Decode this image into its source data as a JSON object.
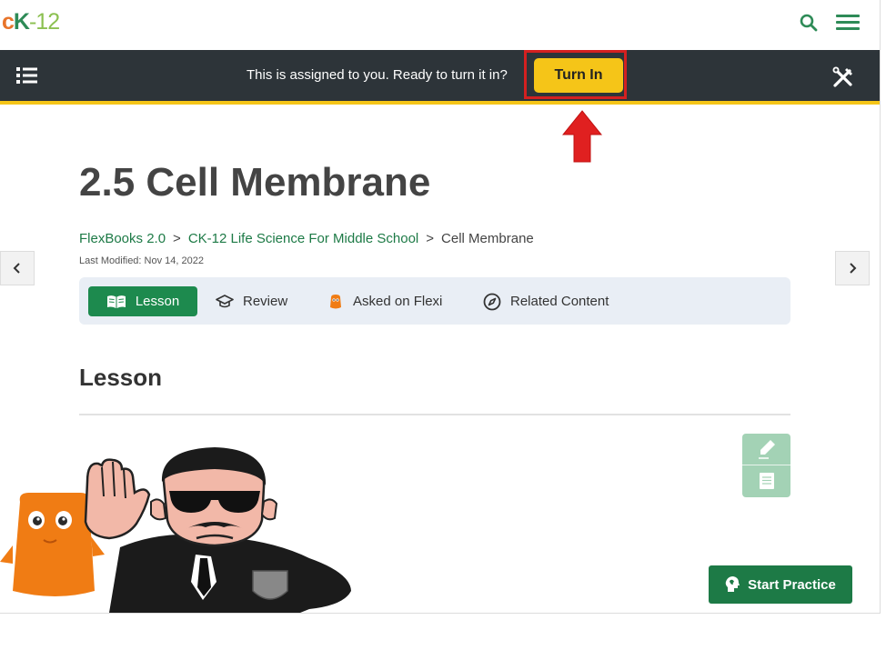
{
  "header": {
    "logo_c": "c",
    "logo_k": "K",
    "logo_rest": "-12",
    "search_icon": "search-icon",
    "menu_icon": "hamburger-menu-icon"
  },
  "assignment_bar": {
    "message": "This is assigned to you. Ready to turn it in?",
    "turn_in_label": "Turn In",
    "accent_color": "#f5c518",
    "highlight_color": "#d42020"
  },
  "page": {
    "title": "2.5 Cell Membrane",
    "breadcrumb": [
      {
        "label": "FlexBooks 2.0"
      },
      {
        "label": "CK-12 Life Science For Middle School"
      },
      {
        "label": "Cell Membrane"
      }
    ],
    "breadcrumb_separator": ">",
    "last_modified": "Last Modified: Nov 14, 2022"
  },
  "tabs": [
    {
      "label": "Lesson",
      "icon": "book-icon",
      "active": true
    },
    {
      "label": "Review",
      "icon": "graduation-cap-icon"
    },
    {
      "label": "Asked on Flexi",
      "icon": "flexi-icon"
    },
    {
      "label": "Related Content",
      "icon": "compass-icon"
    }
  ],
  "lesson": {
    "section_title": "Lesson"
  },
  "start_practice_label": "Start Practice",
  "brand_green": "#1d7a46"
}
